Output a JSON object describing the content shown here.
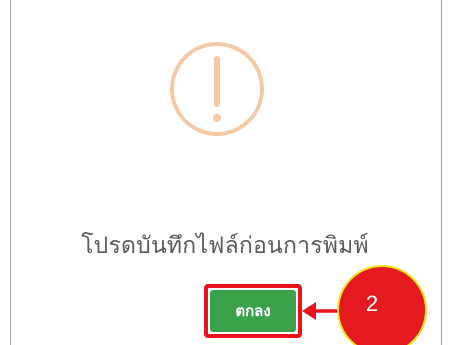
{
  "dialog": {
    "icon": "exclamation-circle-icon",
    "icon_color": "#f5c8a6",
    "message": "โปรดบันทึกไฟล์ก่อนการพิมพ์",
    "ok_button_label": "ตกลง",
    "ok_button_color": "#3aa24a"
  },
  "annotation": {
    "step_number": "2",
    "highlight_color": "#e8141c",
    "badge_color": "#e6191f",
    "badge_border_color": "#f2e41c"
  }
}
